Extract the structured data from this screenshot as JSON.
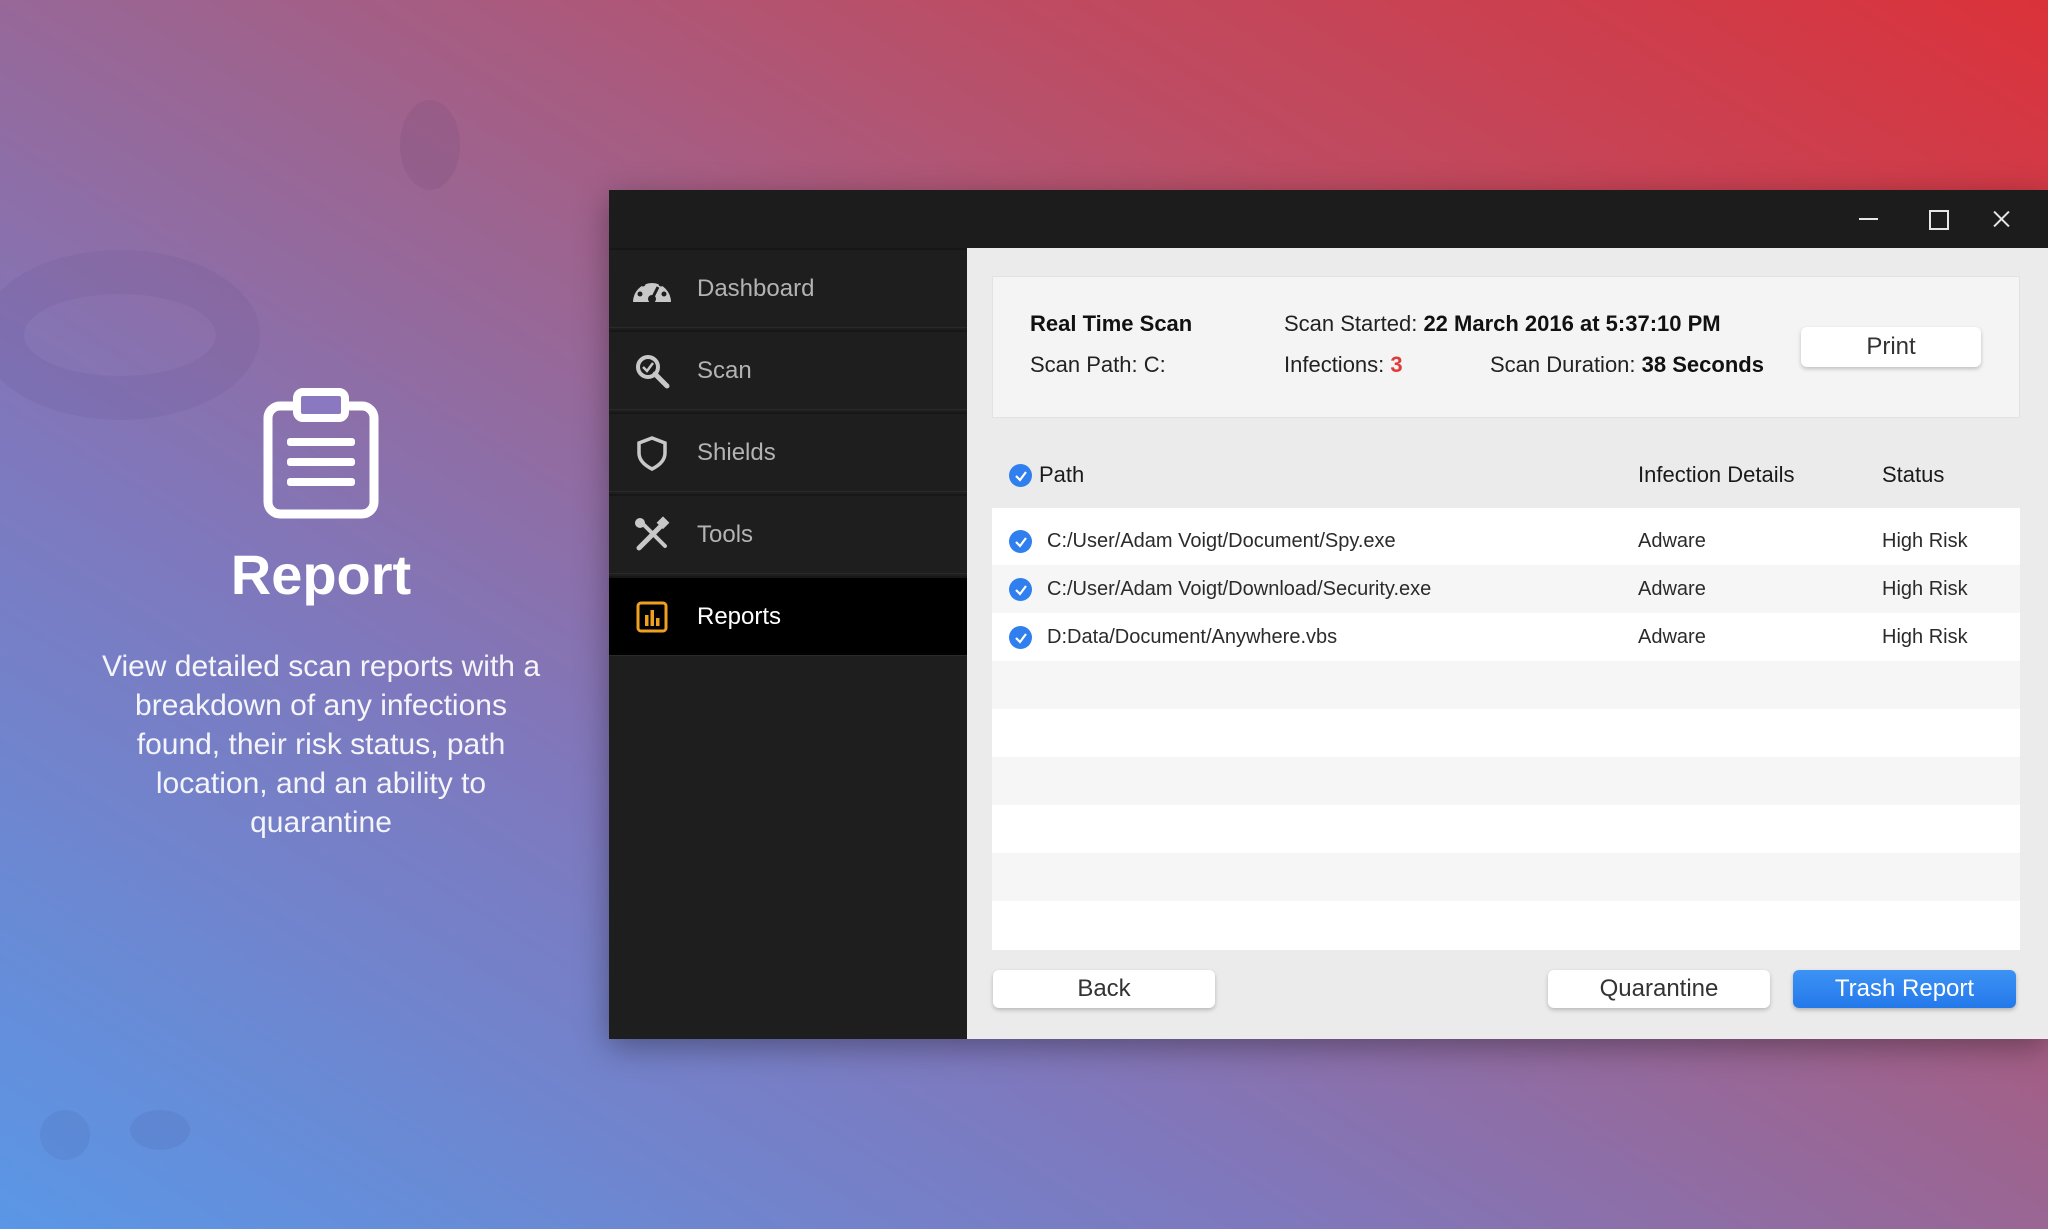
{
  "promo": {
    "icon": "clipboard-icon",
    "title": "Report",
    "description": "View detailed scan reports with a breakdown of any infections found, their risk status, path location, and an ability to quarantine"
  },
  "window": {
    "controls": [
      "minimize-icon",
      "maximize-icon",
      "close-icon"
    ]
  },
  "sidebar": {
    "items": [
      {
        "label": "Dashboard",
        "icon": "gauge-icon"
      },
      {
        "label": "Scan",
        "icon": "magnifier-icon"
      },
      {
        "label": "Shields",
        "icon": "shield-icon"
      },
      {
        "label": "Tools",
        "icon": "tools-icon"
      },
      {
        "label": "Reports",
        "icon": "bar-chart-icon",
        "active": true
      }
    ]
  },
  "summary": {
    "scan_type": "Real Time Scan",
    "scan_path_label": "Scan Path: C:",
    "scan_started_label": "Scan Started:",
    "scan_started_value": "22 March 2016 at 5:37:10 PM",
    "infections_label": "Infections:",
    "infections_value": "3",
    "duration_label": "Scan Duration:",
    "duration_value": "38 Seconds",
    "print_label": "Print"
  },
  "table": {
    "headers": {
      "path": "Path",
      "details": "Infection Details",
      "status": "Status"
    },
    "rows": [
      {
        "path": "C:/User/Adam Voigt/Document/Spy.exe",
        "details": "Adware",
        "status": "High Risk"
      },
      {
        "path": "C:/User/Adam Voigt/Download/Security.exe",
        "details": "Adware",
        "status": "High Risk"
      },
      {
        "path": "D:Data/Document/Anywhere.vbs",
        "details": "Adware",
        "status": "High Risk"
      }
    ]
  },
  "actions": {
    "back": "Back",
    "quarantine": "Quarantine",
    "trash": "Trash Report"
  },
  "colors": {
    "accent_blue": "#2f7fee",
    "infection_red": "#e03a3a",
    "reports_icon_orange": "#f0a020"
  }
}
